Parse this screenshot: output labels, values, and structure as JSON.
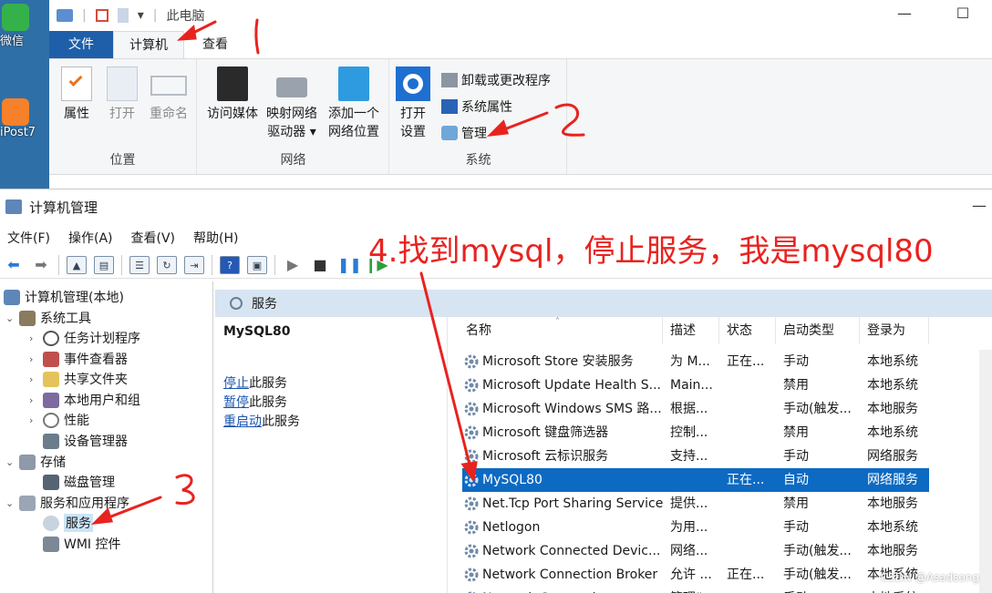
{
  "desktop": {
    "icons": [
      {
        "label": "微信",
        "color": "#34b14b"
      },
      {
        "label": "iPost7",
        "color": "#f7812a"
      }
    ]
  },
  "explorer": {
    "title": "此电脑",
    "tabs": [
      {
        "label": "文件"
      },
      {
        "label": "计算机"
      },
      {
        "label": "查看"
      }
    ],
    "groups": {
      "location": {
        "name": "位置",
        "buttons": [
          {
            "label": "属性",
            "icon": "properties-icon",
            "disabled": false
          },
          {
            "label": "打开",
            "icon": "open-icon",
            "disabled": true
          },
          {
            "label": "重命名",
            "icon": "rename-icon",
            "disabled": true
          }
        ]
      },
      "network": {
        "name": "网络",
        "buttons": [
          {
            "label": "访问媒体",
            "icon": "media-icon"
          },
          {
            "label": "映射网络",
            "label2": "驱动器",
            "icon": "map-drive-icon"
          },
          {
            "label": "添加一个",
            "label2": "网络位置",
            "icon": "network-location-icon"
          }
        ]
      },
      "system": {
        "name": "系统",
        "open_settings": {
          "label": "打开",
          "label2": "设置"
        },
        "items": [
          {
            "label": "卸载或更改程序",
            "icon": "uninstall-icon"
          },
          {
            "label": "系统属性",
            "icon": "system-properties-icon"
          },
          {
            "label": "管理",
            "icon": "manage-icon"
          }
        ]
      }
    },
    "accent": "#1f5fa9"
  },
  "mgmt": {
    "title": "计算机管理",
    "menu": [
      "文件(F)",
      "操作(A)",
      "查看(V)",
      "帮助(H)"
    ],
    "tree": [
      {
        "label": "计算机管理(本地)",
        "level": 0,
        "twisty": ""
      },
      {
        "label": "系统工具",
        "level": 1,
        "twisty": "⌄"
      },
      {
        "label": "任务计划程序",
        "level": 2,
        "twisty": "›"
      },
      {
        "label": "事件查看器",
        "level": 2,
        "twisty": "›"
      },
      {
        "label": "共享文件夹",
        "level": 2,
        "twisty": "›"
      },
      {
        "label": "本地用户和组",
        "level": 2,
        "twisty": "›"
      },
      {
        "label": "性能",
        "level": 2,
        "twisty": "›"
      },
      {
        "label": "设备管理器",
        "level": 2,
        "twisty": ""
      },
      {
        "label": "存储",
        "level": 1,
        "twisty": "⌄"
      },
      {
        "label": "磁盘管理",
        "level": 2,
        "twisty": ""
      },
      {
        "label": "服务和应用程序",
        "level": 1,
        "twisty": "⌄"
      },
      {
        "label": "服务",
        "level": 2,
        "twisty": "",
        "selected": true
      },
      {
        "label": "WMI 控件",
        "level": 2,
        "twisty": ""
      }
    ],
    "content_title": "服务",
    "selected_service": "MySQL80",
    "actions": [
      {
        "link": "停止",
        "rest": "此服务"
      },
      {
        "link": "暂停",
        "rest": "此服务"
      },
      {
        "link": "重启动",
        "rest": "此服务"
      }
    ],
    "columns": [
      "名称",
      "描述",
      "状态",
      "启动类型",
      "登录为"
    ],
    "rows": [
      {
        "name": "Microsoft Store 安装服务",
        "desc": "为 M...",
        "status": "正在...",
        "start": "手动",
        "logon": "本地系统"
      },
      {
        "name": "Microsoft Update Health S...",
        "desc": "Main...",
        "status": "",
        "start": "禁用",
        "logon": "本地系统"
      },
      {
        "name": "Microsoft Windows SMS 路...",
        "desc": "根据...",
        "status": "",
        "start": "手动(触发...",
        "logon": "本地服务"
      },
      {
        "name": "Microsoft 键盘筛选器",
        "desc": "控制...",
        "status": "",
        "start": "禁用",
        "logon": "本地系统"
      },
      {
        "name": "Microsoft 云标识服务",
        "desc": "支持...",
        "status": "",
        "start": "手动",
        "logon": "网络服务"
      },
      {
        "name": "MySQL80",
        "desc": "",
        "status": "正在...",
        "start": "自动",
        "logon": "网络服务",
        "selected": true
      },
      {
        "name": "Net.Tcp Port Sharing Service",
        "desc": "提供...",
        "status": "",
        "start": "禁用",
        "logon": "本地服务"
      },
      {
        "name": "Netlogon",
        "desc": "为用...",
        "status": "",
        "start": "手动",
        "logon": "本地系统"
      },
      {
        "name": "Network Connected Devic...",
        "desc": "网络...",
        "status": "",
        "start": "手动(触发...",
        "logon": "本地服务"
      },
      {
        "name": "Network Connection Broker",
        "desc": "允许 ...",
        "status": "正在...",
        "start": "手动(触发...",
        "logon": "本地系统"
      },
      {
        "name": "Network Connections",
        "desc": "管理“...",
        "status": "",
        "start": "手动",
        "logon": "本地系统"
      }
    ],
    "selection_color": "#0d6ac2"
  },
  "annotations": {
    "step4": "4.找到mysql，停止服务，我是mysql80",
    "color": "#e8231f"
  },
  "watermark": "CSDN @Asadsong"
}
